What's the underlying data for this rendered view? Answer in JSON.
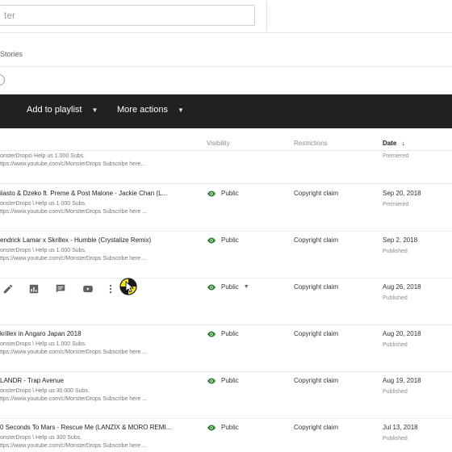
{
  "filter": {
    "placeholder": "ter"
  },
  "tabs": {
    "stories": "Stories"
  },
  "action_bar": {
    "add_to_playlist": "Add to playlist",
    "more_actions": "More actions"
  },
  "columns": {
    "visibility": "Visibility",
    "restrictions": "Restrictions",
    "date": "Date"
  },
  "colors": {
    "accent_dark": "#212121",
    "public_green": "#2e7d32"
  },
  "top_partial": {
    "desc": "onsterDrops\\ Help us 1.000 Subs.",
    "desc2": "ttps://www.youtube.com/c/MonsterDrops Subscribe here...",
    "status": "Premiered"
  },
  "rows": [
    {
      "title": "iiasto & Dzeko ft. Preme & Post Malone - Jackie Chan (L...",
      "desc": "onsterDrops \\ Help us 1.000 Subs.",
      "desc2": "ttps://www.youtube.com/c/MonsterDrops Subscribe here ...",
      "visibility": "Public",
      "restriction": "Copyright claim",
      "date": "Sep 20, 2018",
      "status": "Premiered"
    },
    {
      "title": "endrick Lamar x Skrillex - Humble (Crystalize Remix)",
      "desc": "onsterDrops \\ Help us 1.000 Subs.",
      "desc2": "ttps://www.youtube.com/c/MonsterDrops Subscribe here ...",
      "visibility": "Public",
      "restriction": "Copyright claim",
      "date": "Sep 2, 2018",
      "status": "Published"
    },
    {
      "title": "",
      "desc": "",
      "desc2": "",
      "visibility": "Public",
      "restriction": "Copyright claim",
      "date": "Aug 26, 2018",
      "status": "Published"
    },
    {
      "title": "krillex in Angaro Japan 2018",
      "desc": "onsterDrops \\ Help us 1.000 Subs.",
      "desc2": "ttps://www.youtube.com/c/MonsterDrops Subscribe here ...",
      "visibility": "Public",
      "restriction": "Copyright claim",
      "date": "Aug 20, 2018",
      "status": "Published"
    },
    {
      "title": "LANDR - Trap Avenue",
      "desc": "onsterDrops \\ Help us 30.000 Subs.",
      "desc2": "ttps://www.youtube.com/c/MonsterDrops Subscribe here ...",
      "visibility": "Public",
      "restriction": "Copyright claim",
      "date": "Aug 19, 2018",
      "status": "Published"
    },
    {
      "title": "0 Seconds To Mars - Rescue Me (LANZIX & MORO REMI...",
      "desc": "onsterDrops \\ Help us 300 Subs.",
      "desc2": "ttps://www.youtube.com/c/MonsterDrops Subscribe here ...",
      "visibility": "Public",
      "restriction": "Copyright claim",
      "date": "Jul 13, 2018",
      "status": "Published"
    }
  ]
}
